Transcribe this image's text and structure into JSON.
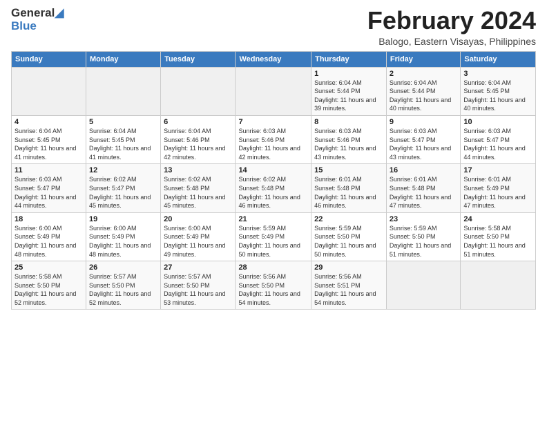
{
  "logo": {
    "part1": "General",
    "part2": "Blue"
  },
  "title": "February 2024",
  "subtitle": "Balogo, Eastern Visayas, Philippines",
  "days_of_week": [
    "Sunday",
    "Monday",
    "Tuesday",
    "Wednesday",
    "Thursday",
    "Friday",
    "Saturday"
  ],
  "weeks": [
    [
      {
        "day": "",
        "info": ""
      },
      {
        "day": "",
        "info": ""
      },
      {
        "day": "",
        "info": ""
      },
      {
        "day": "",
        "info": ""
      },
      {
        "day": "1",
        "info": "Sunrise: 6:04 AM\nSunset: 5:44 PM\nDaylight: 11 hours and 39 minutes."
      },
      {
        "day": "2",
        "info": "Sunrise: 6:04 AM\nSunset: 5:44 PM\nDaylight: 11 hours and 40 minutes."
      },
      {
        "day": "3",
        "info": "Sunrise: 6:04 AM\nSunset: 5:45 PM\nDaylight: 11 hours and 40 minutes."
      }
    ],
    [
      {
        "day": "4",
        "info": "Sunrise: 6:04 AM\nSunset: 5:45 PM\nDaylight: 11 hours and 41 minutes."
      },
      {
        "day": "5",
        "info": "Sunrise: 6:04 AM\nSunset: 5:45 PM\nDaylight: 11 hours and 41 minutes."
      },
      {
        "day": "6",
        "info": "Sunrise: 6:04 AM\nSunset: 5:46 PM\nDaylight: 11 hours and 42 minutes."
      },
      {
        "day": "7",
        "info": "Sunrise: 6:03 AM\nSunset: 5:46 PM\nDaylight: 11 hours and 42 minutes."
      },
      {
        "day": "8",
        "info": "Sunrise: 6:03 AM\nSunset: 5:46 PM\nDaylight: 11 hours and 43 minutes."
      },
      {
        "day": "9",
        "info": "Sunrise: 6:03 AM\nSunset: 5:47 PM\nDaylight: 11 hours and 43 minutes."
      },
      {
        "day": "10",
        "info": "Sunrise: 6:03 AM\nSunset: 5:47 PM\nDaylight: 11 hours and 44 minutes."
      }
    ],
    [
      {
        "day": "11",
        "info": "Sunrise: 6:03 AM\nSunset: 5:47 PM\nDaylight: 11 hours and 44 minutes."
      },
      {
        "day": "12",
        "info": "Sunrise: 6:02 AM\nSunset: 5:47 PM\nDaylight: 11 hours and 45 minutes."
      },
      {
        "day": "13",
        "info": "Sunrise: 6:02 AM\nSunset: 5:48 PM\nDaylight: 11 hours and 45 minutes."
      },
      {
        "day": "14",
        "info": "Sunrise: 6:02 AM\nSunset: 5:48 PM\nDaylight: 11 hours and 46 minutes."
      },
      {
        "day": "15",
        "info": "Sunrise: 6:01 AM\nSunset: 5:48 PM\nDaylight: 11 hours and 46 minutes."
      },
      {
        "day": "16",
        "info": "Sunrise: 6:01 AM\nSunset: 5:48 PM\nDaylight: 11 hours and 47 minutes."
      },
      {
        "day": "17",
        "info": "Sunrise: 6:01 AM\nSunset: 5:49 PM\nDaylight: 11 hours and 47 minutes."
      }
    ],
    [
      {
        "day": "18",
        "info": "Sunrise: 6:00 AM\nSunset: 5:49 PM\nDaylight: 11 hours and 48 minutes."
      },
      {
        "day": "19",
        "info": "Sunrise: 6:00 AM\nSunset: 5:49 PM\nDaylight: 11 hours and 48 minutes."
      },
      {
        "day": "20",
        "info": "Sunrise: 6:00 AM\nSunset: 5:49 PM\nDaylight: 11 hours and 49 minutes."
      },
      {
        "day": "21",
        "info": "Sunrise: 5:59 AM\nSunset: 5:49 PM\nDaylight: 11 hours and 50 minutes."
      },
      {
        "day": "22",
        "info": "Sunrise: 5:59 AM\nSunset: 5:50 PM\nDaylight: 11 hours and 50 minutes."
      },
      {
        "day": "23",
        "info": "Sunrise: 5:59 AM\nSunset: 5:50 PM\nDaylight: 11 hours and 51 minutes."
      },
      {
        "day": "24",
        "info": "Sunrise: 5:58 AM\nSunset: 5:50 PM\nDaylight: 11 hours and 51 minutes."
      }
    ],
    [
      {
        "day": "25",
        "info": "Sunrise: 5:58 AM\nSunset: 5:50 PM\nDaylight: 11 hours and 52 minutes."
      },
      {
        "day": "26",
        "info": "Sunrise: 5:57 AM\nSunset: 5:50 PM\nDaylight: 11 hours and 52 minutes."
      },
      {
        "day": "27",
        "info": "Sunrise: 5:57 AM\nSunset: 5:50 PM\nDaylight: 11 hours and 53 minutes."
      },
      {
        "day": "28",
        "info": "Sunrise: 5:56 AM\nSunset: 5:50 PM\nDaylight: 11 hours and 54 minutes."
      },
      {
        "day": "29",
        "info": "Sunrise: 5:56 AM\nSunset: 5:51 PM\nDaylight: 11 hours and 54 minutes."
      },
      {
        "day": "",
        "info": ""
      },
      {
        "day": "",
        "info": ""
      }
    ]
  ]
}
